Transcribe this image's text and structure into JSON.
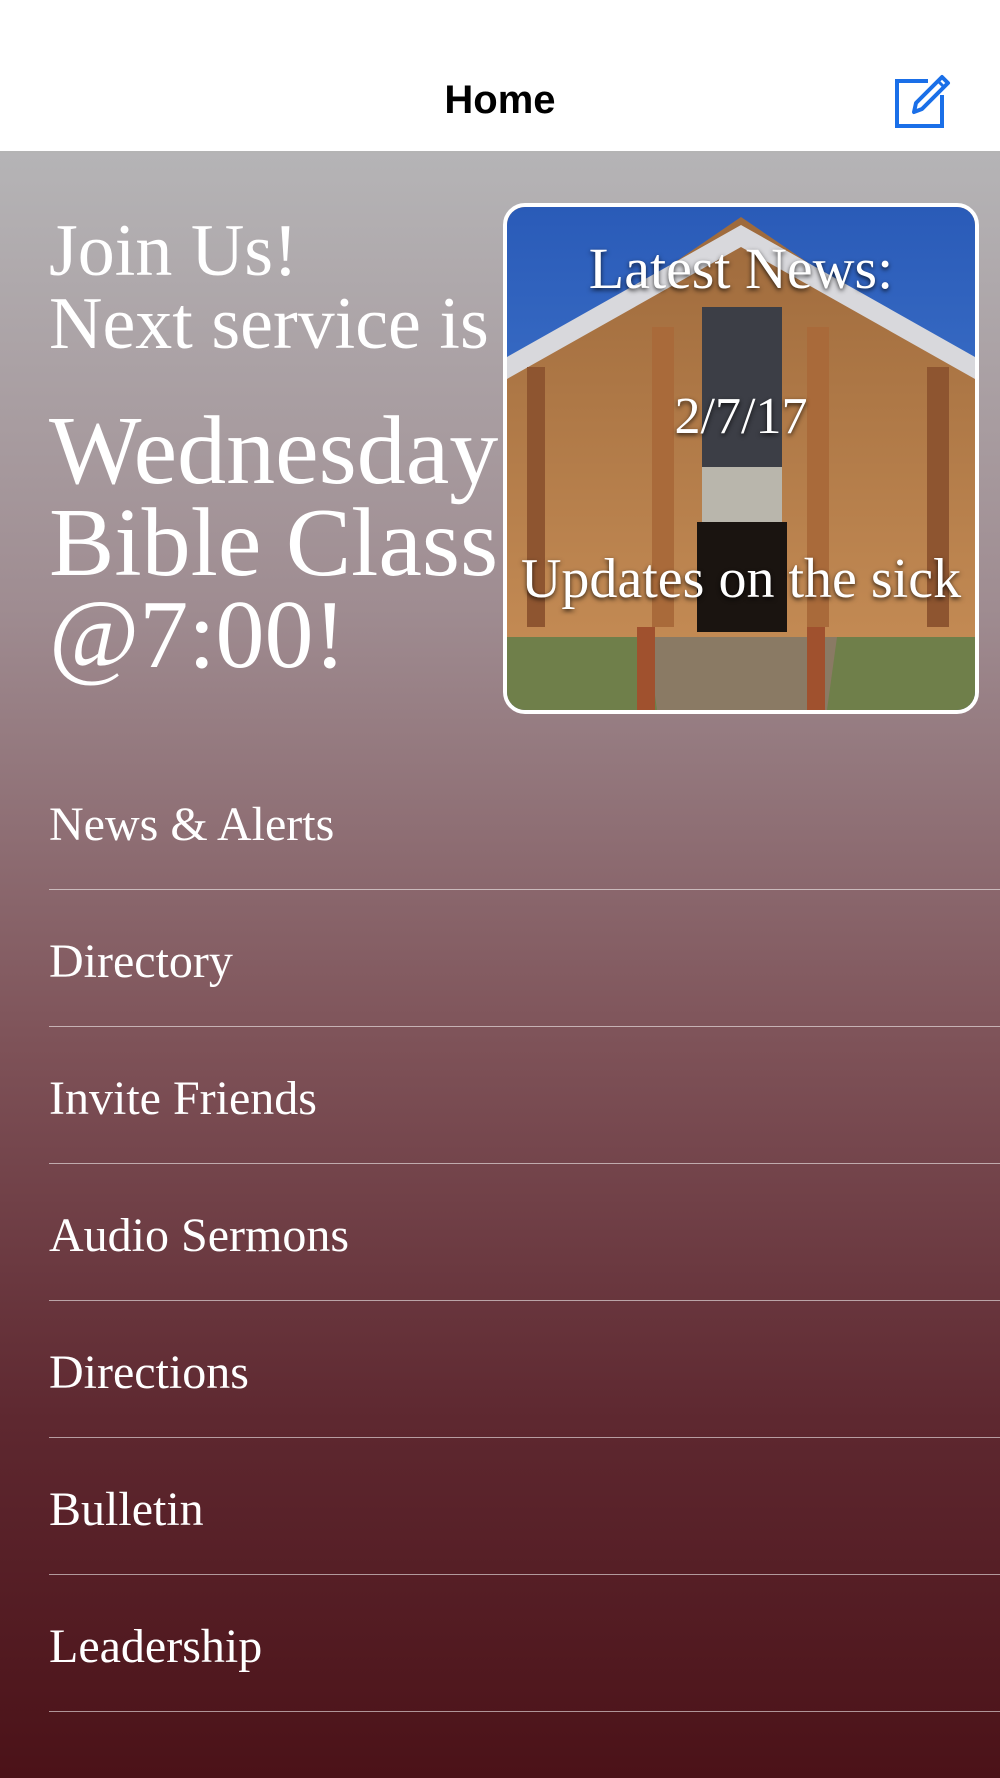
{
  "navbar": {
    "title": "Home",
    "compose_icon": "compose-icon",
    "accent_color": "#1a6fe8"
  },
  "hero": {
    "join_line1": "Join Us!",
    "join_line2": "Next service is",
    "service_line1": "Wednesday",
    "service_line2": "Bible Class",
    "service_line3": "@7:00!"
  },
  "news_card": {
    "heading": "Latest News:",
    "date": "2/7/17",
    "description": "Updates on the sick",
    "background": "church-photo"
  },
  "menu": {
    "items": [
      {
        "label": "News & Alerts"
      },
      {
        "label": "Directory"
      },
      {
        "label": "Invite Friends"
      },
      {
        "label": "Audio Sermons"
      },
      {
        "label": "Directions"
      },
      {
        "label": "Bulletin"
      },
      {
        "label": "Leadership"
      }
    ]
  },
  "colors": {
    "gradient_top": "#b5b4b6",
    "gradient_bottom": "#4b1218",
    "text": "#ffffff"
  }
}
